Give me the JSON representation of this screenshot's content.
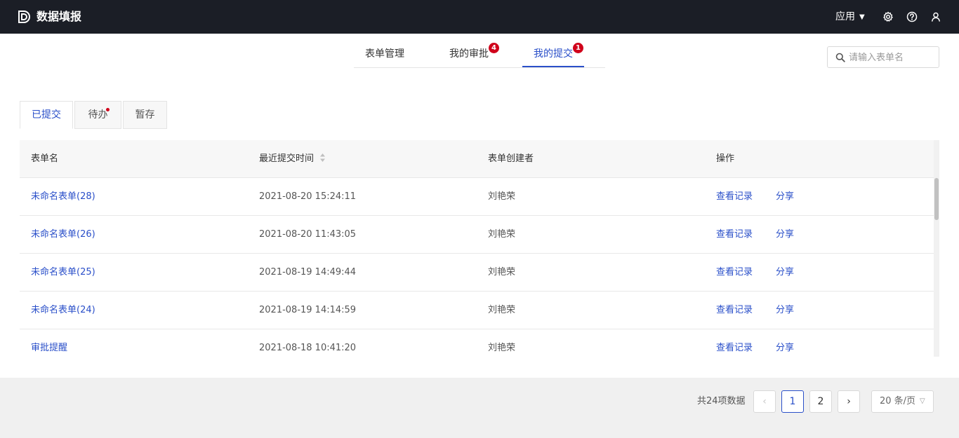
{
  "header": {
    "app_title": "数据填报",
    "apps_label": "应用"
  },
  "nav": {
    "tabs": [
      {
        "label": "表单管理",
        "badge": ""
      },
      {
        "label": "我的审批",
        "badge": "4"
      },
      {
        "label": "我的提交",
        "badge": "1",
        "active": true
      }
    ],
    "search_placeholder": "请输入表单名"
  },
  "subtabs": [
    {
      "label": "已提交",
      "active": true
    },
    {
      "label": "待办",
      "dot": true
    },
    {
      "label": "暂存"
    }
  ],
  "table": {
    "columns": [
      "表单名",
      "最近提交时间",
      "表单创建者",
      "操作"
    ],
    "rows": [
      {
        "name": "未命名表单(28)",
        "time": "2021-08-20 15:24:11",
        "creator": "刘艳荣",
        "action_view": "查看记录",
        "action_share": "分享"
      },
      {
        "name": "未命名表单(26)",
        "time": "2021-08-20 11:43:05",
        "creator": "刘艳荣",
        "action_view": "查看记录",
        "action_share": "分享"
      },
      {
        "name": "未命名表单(25)",
        "time": "2021-08-19 14:49:44",
        "creator": "刘艳荣",
        "action_view": "查看记录",
        "action_share": "分享"
      },
      {
        "name": "未命名表单(24)",
        "time": "2021-08-19 14:14:59",
        "creator": "刘艳荣",
        "action_view": "查看记录",
        "action_share": "分享"
      },
      {
        "name": "审批提醒",
        "time": "2021-08-18 10:41:20",
        "creator": "刘艳荣",
        "action_view": "查看记录",
        "action_share": "分享"
      }
    ]
  },
  "pagination": {
    "total_text": "共24项数据",
    "prev_label": "‹",
    "pages": [
      "1",
      "2"
    ],
    "current_page": "1",
    "next_label": "›",
    "page_size_label": "20 条/页"
  },
  "colors": {
    "accent": "#2a4fc9",
    "topbar": "#1b1e26",
    "badge": "#d0021b"
  }
}
